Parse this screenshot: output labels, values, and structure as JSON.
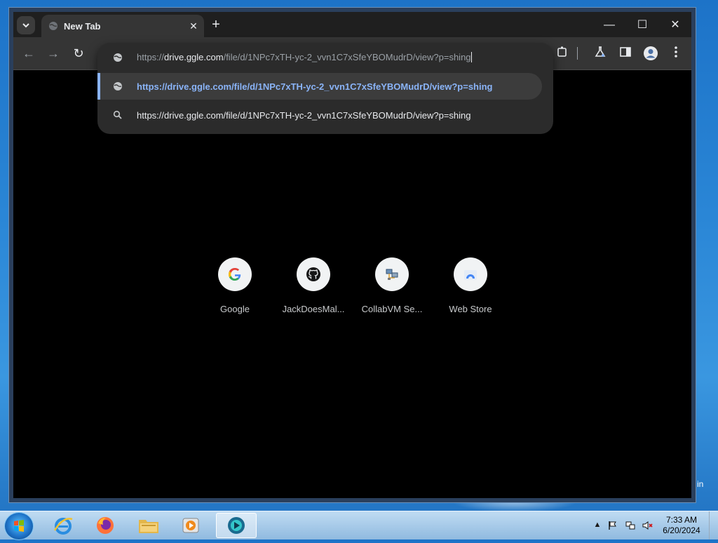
{
  "browser": {
    "tab": {
      "title": "New Tab",
      "close_glyph": "✕"
    },
    "new_tab_glyph": "+",
    "window_controls": {
      "minimize": "—",
      "maximize": "☐",
      "close": "✕"
    },
    "toolbar": {
      "back": "←",
      "forward": "→",
      "reload": "↻"
    },
    "omnibox": {
      "typed_prefix": "https://",
      "typed_domain": "drive.ggle.com",
      "typed_path": "/file/d/1NPc7xTH-yc-2_vvn1C7xSfeYBOMudrD/view?p=shing",
      "suggestions": [
        {
          "text": "https://drive.ggle.com/file/d/1NPc7xTH-yc-2_vvn1C7xSfeYBOMudrD/view?p=shing",
          "icon": "globe-icon"
        },
        {
          "text": "https://drive.ggle.com/file/d/1NPc7xTH-yc-2_vvn1C7xSfeYBOMudrD/view?p=shing",
          "icon": "search-icon"
        }
      ]
    },
    "shortcuts": [
      {
        "label": "Google",
        "icon": "google-icon"
      },
      {
        "label": "JackDoesMal...",
        "icon": "github-icon"
      },
      {
        "label": "CollabVM Se...",
        "icon": "network-icon"
      },
      {
        "label": "Web Store",
        "icon": "web-store-icon"
      }
    ]
  },
  "desktop": {
    "partial_text": "in"
  },
  "taskbar": {
    "clock_time": "7:33 AM",
    "clock_date": "6/20/2024"
  },
  "colors": {
    "accent": "#8ab4f8",
    "ntp_background": "#000000",
    "toolbar": "#353535"
  }
}
